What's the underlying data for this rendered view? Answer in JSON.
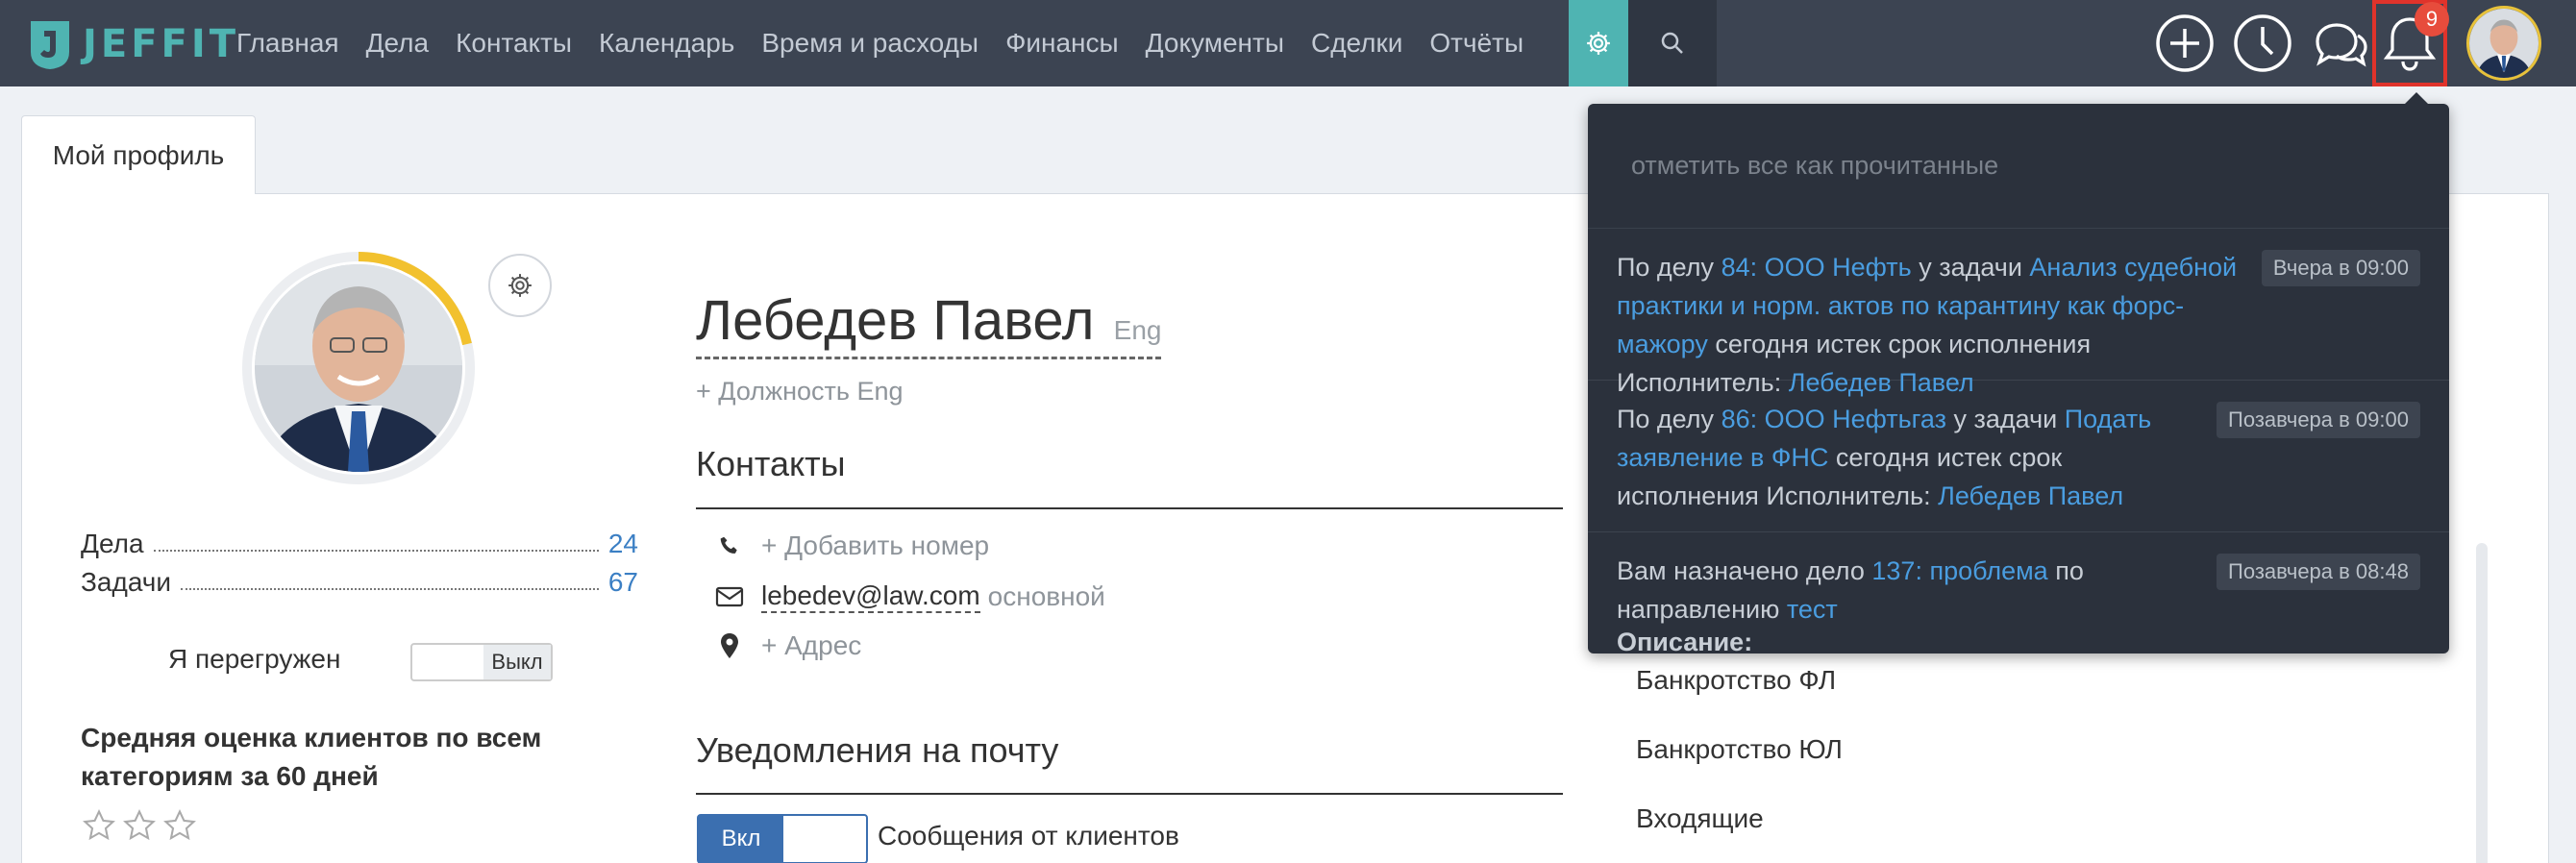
{
  "app": {
    "logo_text": "JEFFIT"
  },
  "nav": {
    "items": [
      "Главная",
      "Дела",
      "Контакты",
      "Календарь",
      "Время и расходы",
      "Финансы",
      "Документы",
      "Сделки",
      "Отчёты"
    ]
  },
  "header": {
    "notification_count": "9",
    "icons": [
      "plus-circle-icon",
      "clock-icon",
      "chat-icon",
      "bell-icon"
    ]
  },
  "tab": {
    "label": "Мой профиль"
  },
  "profile": {
    "name": "Лебедев Павел",
    "name_eng": "Eng",
    "position": "+ Должность Eng",
    "stats": [
      {
        "label": "Дела",
        "value": "24"
      },
      {
        "label": "Задачи",
        "value": "67"
      }
    ],
    "overload_label": "Я перегружен",
    "overload_toggle": "Выкл",
    "rating_title": "Средняя оценка клиентов по всем категориям за 60 дней",
    "rating_stars": 0
  },
  "contacts": {
    "title": "Контакты",
    "add_phone": "+ Добавить номер",
    "email": "lebedev@law.com",
    "email_type": "основной",
    "add_address": "+ Адрес"
  },
  "email_notifications": {
    "title": "Уведомления на почту",
    "toggle_label": "Вкл",
    "item_label": "Сообщения от клиентов"
  },
  "right_list": {
    "items": [
      "Банкротство ФЛ",
      "Банкротство ЮЛ",
      "Входящие"
    ]
  },
  "notifications": {
    "mark_all": "отметить все как прочитанные",
    "items": [
      {
        "time": "Вчера в 09:00",
        "p1": "По делу ",
        "case_link": "84: ООО Нефть",
        "p2": " у задачи ",
        "task_link": "Анализ судебной практики и норм. актов по карантину как форс-мажору",
        "p3": " сегодня истек срок исполнения Исполнитель: ",
        "user_link": "Лебедев Павел"
      },
      {
        "time": "Позавчера в 09:00",
        "p1": "По делу ",
        "case_link": "86: ООО Нефтьгаз",
        "p2": " у задачи ",
        "task_link": "Подать заявление в ФНС",
        "p3": " сегодня истек срок исполнения Исполнитель: ",
        "user_link": "Лебедев Павел"
      },
      {
        "time": "Позавчера в 08:48",
        "p1": "Вам назначено дело ",
        "case_link": "137: проблема",
        "p2": " по направлению ",
        "task_link": "тест",
        "p3": "",
        "user_link": "",
        "description_label": "Описание:"
      }
    ]
  }
}
